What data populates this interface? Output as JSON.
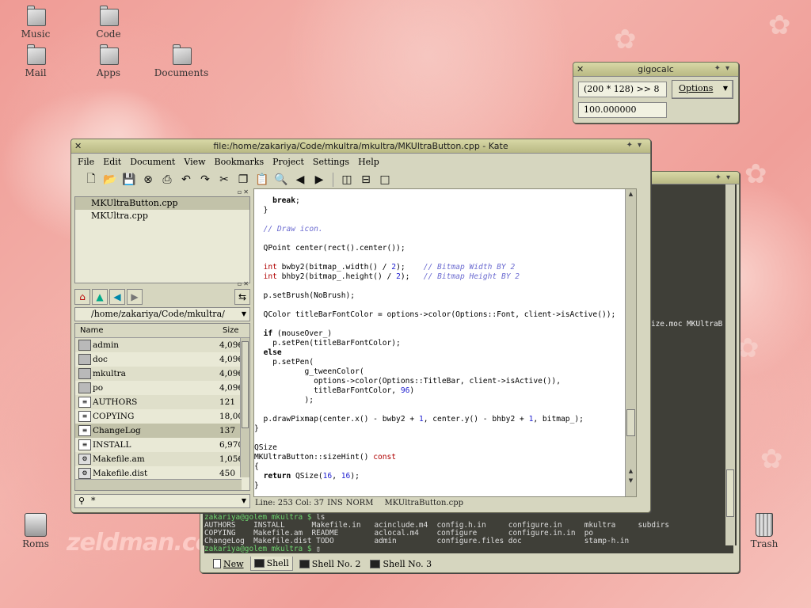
{
  "desktop": {
    "icons": [
      {
        "label": "Music"
      },
      {
        "label": "Code"
      },
      {
        "label": "Mail"
      },
      {
        "label": "Apps"
      },
      {
        "label": "Documents"
      },
      {
        "label": "Roms"
      },
      {
        "label": "Trash"
      }
    ],
    "watermark": "zeldman.com"
  },
  "gigocalc": {
    "title": "gigocalc",
    "expression": "(200 * 128) >> 8",
    "options_label": "Options",
    "result": "100.000000"
  },
  "kate": {
    "title": "file:/home/zakariya/Code/mkultra/mkultra/MKUltraButton.cpp - Kate",
    "menu": [
      "File",
      "Edit",
      "Document",
      "View",
      "Bookmarks",
      "Project",
      "Settings",
      "Help"
    ],
    "open_files": [
      "MKUltraButton.cpp",
      "MKUltra.cpp"
    ],
    "path": "/home/zakariya/Code/mkultra/",
    "columns": {
      "name": "Name",
      "size": "Size"
    },
    "files": [
      {
        "name": "admin",
        "size": "4,096",
        "icon": "folder-icon"
      },
      {
        "name": "doc",
        "size": "4,096",
        "icon": "folder-icon"
      },
      {
        "name": "mkultra",
        "size": "4,096",
        "icon": "folder-icon"
      },
      {
        "name": "po",
        "size": "4,096",
        "icon": "folder-icon"
      },
      {
        "name": "AUTHORS",
        "size": "121",
        "icon": "text-file-icon"
      },
      {
        "name": "COPYING",
        "size": "18,00",
        "icon": "text-file-icon"
      },
      {
        "name": "ChangeLog",
        "size": "137",
        "icon": "text-file-icon"
      },
      {
        "name": "INSTALL",
        "size": "6,970",
        "icon": "text-file-icon"
      },
      {
        "name": "Makefile.am",
        "size": "1,056",
        "icon": "gear-file-icon"
      },
      {
        "name": "Makefile.dist",
        "size": "450",
        "icon": "gear-file-icon"
      }
    ],
    "filter": "*",
    "status": {
      "position": "Line: 253 Col: 37",
      "mode1": "INS",
      "mode2": "NORM",
      "filename": "MKUltraButton.cpp"
    }
  },
  "konsole": {
    "partial_line": "ize.moc MKUltraB",
    "prompt1": "zakariya@golem mkultra $",
    "command": "ls",
    "ls_rows": [
      "AUTHORS    INSTALL      Makefile.in   acinclude.m4  config.h.in     configure.in     mkultra     subdirs",
      "COPYING    Makefile.am  README        aclocal.m4    configure       configure.in.in  po",
      "ChangeLog  Makefile.dist TODO         admin         configure.files doc              stamp-h.in"
    ],
    "prompt2": "zakariya@golem mkultra $",
    "tabs": [
      "New",
      "Shell",
      "Shell No. 2",
      "Shell No. 3"
    ]
  }
}
